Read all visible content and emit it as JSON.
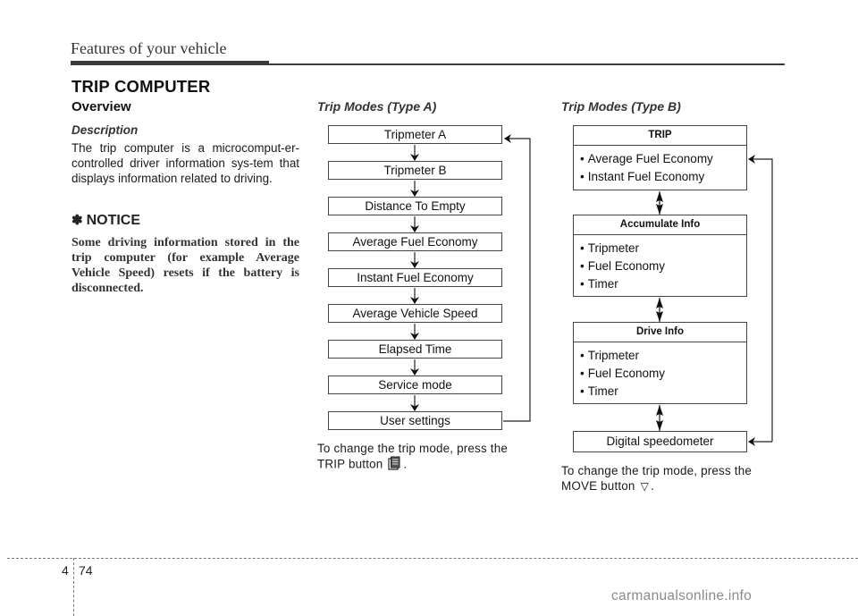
{
  "header": {
    "title": "Features of your vehicle"
  },
  "section": {
    "title": "TRIP COMPUTER",
    "overview": "Overview",
    "description_heading": "Description",
    "description_body": "The trip computer is a microcomput-er-controlled driver information sys-tem that displays information related to driving.",
    "notice_symbol": "✽",
    "notice_heading": "NOTICE",
    "notice_body": "Some driving information stored in the trip computer (for example Average Vehicle Speed) resets if the battery is disconnected."
  },
  "type_a": {
    "heading": "Trip Modes (Type A)",
    "modes": [
      "Tripmeter A",
      "Tripmeter B",
      "Distance To Empty",
      "Average Fuel Economy",
      "Instant Fuel Economy",
      "Average Vehicle Speed",
      "Elapsed Time",
      "Service mode",
      "User settings"
    ],
    "caption_line1": "To change the trip mode, press the",
    "caption_line2": "TRIP button",
    "caption_end": ".",
    "button_icon": "trip-button-icon"
  },
  "type_b": {
    "heading": "Trip Modes (Type B)",
    "groups": [
      {
        "title": "TRIP",
        "items": [
          "Average Fuel Economy",
          "Instant Fuel Economy"
        ]
      },
      {
        "title": "Accumulate Info",
        "items": [
          "Tripmeter",
          "Fuel Economy",
          "Timer"
        ]
      },
      {
        "title": "Drive Info",
        "items": [
          "Tripmeter",
          "Fuel Economy",
          "Timer"
        ]
      }
    ],
    "final_mode": "Digital speedometer",
    "caption_line1": "To change the trip mode, press the",
    "caption_line2": "MOVE button",
    "caption_end": ".",
    "button_symbol": "▽"
  },
  "footer": {
    "chapter": "4",
    "page": "74",
    "watermark": "carmanualsonline.info"
  }
}
